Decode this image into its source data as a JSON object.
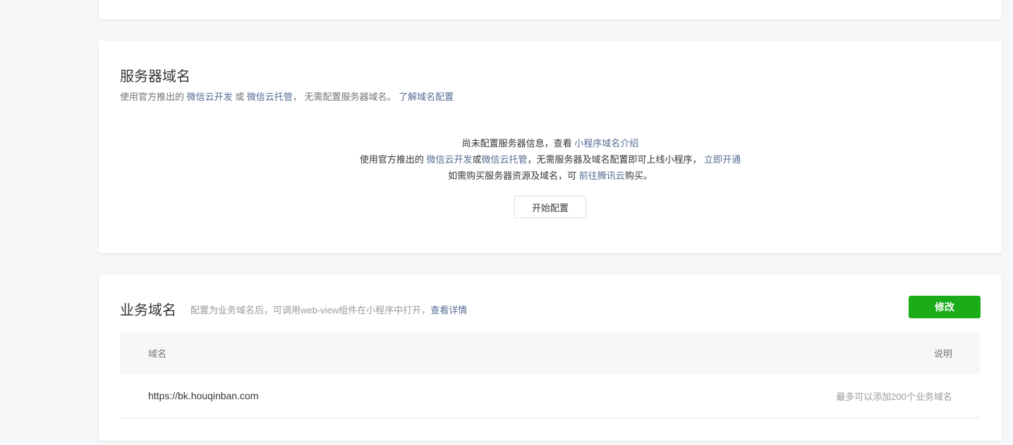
{
  "server": {
    "title": "服务器域名",
    "desc_prefix": "使用官方推出的 ",
    "desc_link1": "微信云开发",
    "desc_or": " 或 ",
    "desc_link2": "微信云托管",
    "desc_mid": "， 无需配置服务器域名。 ",
    "desc_link3": "了解域名配置",
    "line1_text": "尚未配置服务器信息，查看 ",
    "line1_link": "小程序域名介绍",
    "line2_prefix": "使用官方推出的 ",
    "line2_link1": "微信云开发",
    "line2_or": "或",
    "line2_link2": "微信云托管",
    "line2_mid": "，无需服务器及域名配置即可上线小程序， ",
    "line2_link3": "立即开通",
    "line3_prefix": "如需购买服务器资源及域名，可 ",
    "line3_link": "前往腾讯云",
    "line3_suffix": "购买。",
    "start_button": "开始配置"
  },
  "business": {
    "title": "业务域名",
    "desc": "配置为业务域名后，可调用web-view组件在小程序中打开，",
    "desc_link": "查看详情",
    "edit_button": "修改",
    "table": {
      "col_domain": "域名",
      "col_note": "说明",
      "rows": [
        {
          "domain": "https://bk.houqinban.com",
          "note": "最多可以添加200个业务域名"
        }
      ]
    }
  },
  "colors": {
    "link": "#576b95",
    "primary_button": "#1aad19",
    "background": "#f6f7f9"
  }
}
